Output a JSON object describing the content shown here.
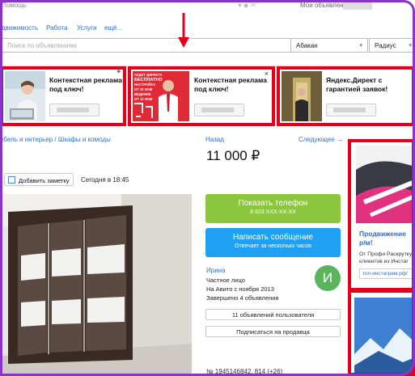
{
  "topbar": {
    "help": "Помощь",
    "my_ads": "Мои объявления"
  },
  "nav": {
    "items": [
      "движимость",
      "Работа",
      "Услуги",
      "ещё..."
    ]
  },
  "search": {
    "placeholder": "Поиск по объявлениям",
    "city": "Абакан",
    "radius": "Радиус"
  },
  "ads": [
    {
      "text": "Контекстная реклама под ключ!"
    },
    {
      "text": "Контекстная реклама под ключ!",
      "banner_lines": [
        "АУДИТ ДИРЕКТА",
        "БЕСПЛАТНО",
        "НАСТРОЙКА",
        "ОТ 20 000₽",
        "ВЕДЕНИЕ",
        "ОТ 12 000₽"
      ]
    },
    {
      "text": "Яндекс.Директ с гарантией заявок!"
    }
  ],
  "breadcrumbs": "ебель и интерьер / Шкафы и комоды",
  "listing": {
    "back": "Назад",
    "next": "Следующее →",
    "price": "11 000 ₽",
    "add_note": "Добавить заметку",
    "date": "Сегодня в 18:45",
    "id_line": "№ 1945146842, 814 (+26)"
  },
  "actions": {
    "phone_title": "Показать телефон",
    "phone_number": "8 923 XXX-XX-XX",
    "message_title": "Написать сообщение",
    "message_sub": "Отвечает за несколько часов"
  },
  "seller": {
    "name": "Ирина",
    "type": "Частное лицо",
    "since": "На Авито с ноября 2013",
    "completed": "Завершено 4 объявления",
    "avatar_letter": "И",
    "all_ads": "11 объявлений пользователя",
    "subscribe": "Подписаться на продавца"
  },
  "side_ad": {
    "title": "Продвижение р/м!",
    "desc": "От Профи Раскрутку клиентов из Инстаг",
    "link": "топ-инстаграм.рф/"
  },
  "colors": {
    "highlight": "#e3001b",
    "link": "#2d6fd1",
    "phone_button": "#8cc63f",
    "message_button": "#1ea1f2",
    "avatar": "#59b55d",
    "frame": "#8a35c9"
  }
}
